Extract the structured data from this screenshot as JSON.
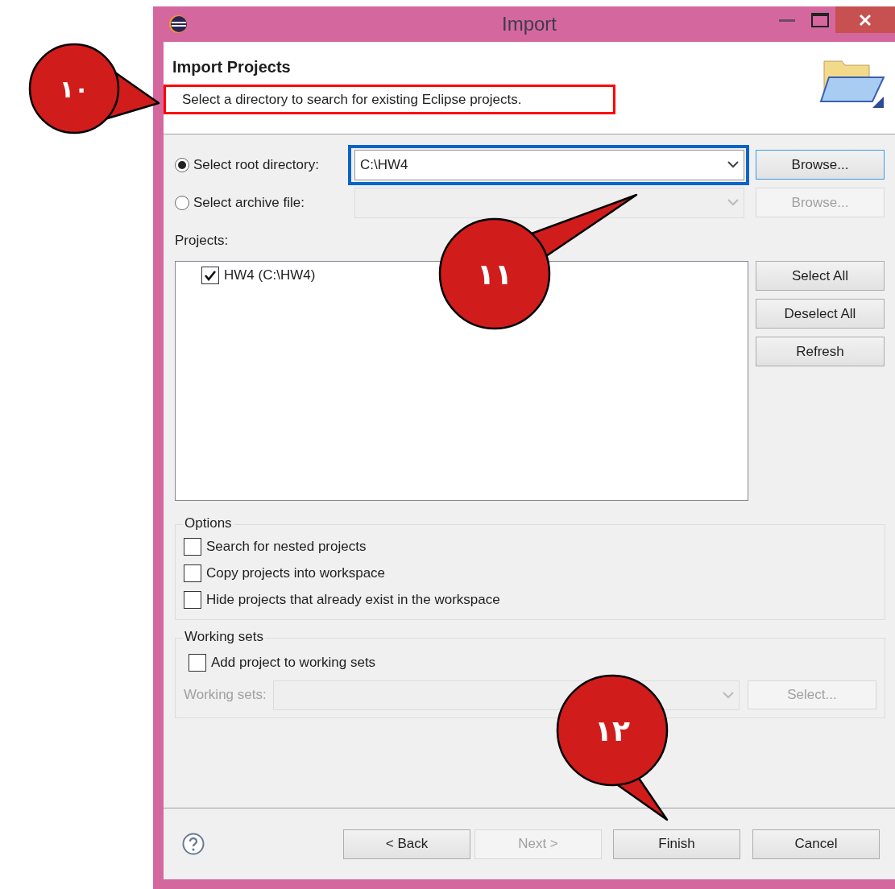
{
  "window": {
    "title": "Import"
  },
  "header": {
    "title": "Import Projects",
    "description": "Select a directory to search for existing Eclipse projects."
  },
  "source": [
    {
      "label": "Select root directory:",
      "selected": true,
      "value": "C:\\HW4",
      "button": "Browse...",
      "disabled": false
    },
    {
      "label": "Select archive file:",
      "selected": false,
      "button": "Browse...",
      "disabled": true
    }
  ],
  "projects": {
    "label": "Projects:",
    "items": [
      {
        "label": "HW4 (C:\\HW4)",
        "checked": true
      }
    ]
  },
  "project_buttons": [
    "Select All",
    "Deselect All",
    "Refresh"
  ],
  "options": {
    "title": "Options",
    "items": [
      {
        "label": "Search for nested projects",
        "checked": false
      },
      {
        "label": "Copy projects into workspace",
        "checked": false
      },
      {
        "label": "Hide projects that already exist in the workspace",
        "checked": false
      }
    ]
  },
  "working_sets": {
    "title": "Working sets",
    "checkbox": {
      "label": "Add project to working sets",
      "checked": false
    },
    "field_label": "Working sets:",
    "button": "Select...",
    "disabled": true
  },
  "footer_buttons": [
    {
      "label": "< Back",
      "disabled": false
    },
    {
      "label": "Next >",
      "disabled": true
    },
    {
      "label": "Finish",
      "disabled": false
    },
    {
      "label": "Cancel",
      "disabled": false
    }
  ],
  "callouts": [
    {
      "label": "١٠"
    },
    {
      "label": "١١"
    },
    {
      "label": "١٢"
    }
  ]
}
